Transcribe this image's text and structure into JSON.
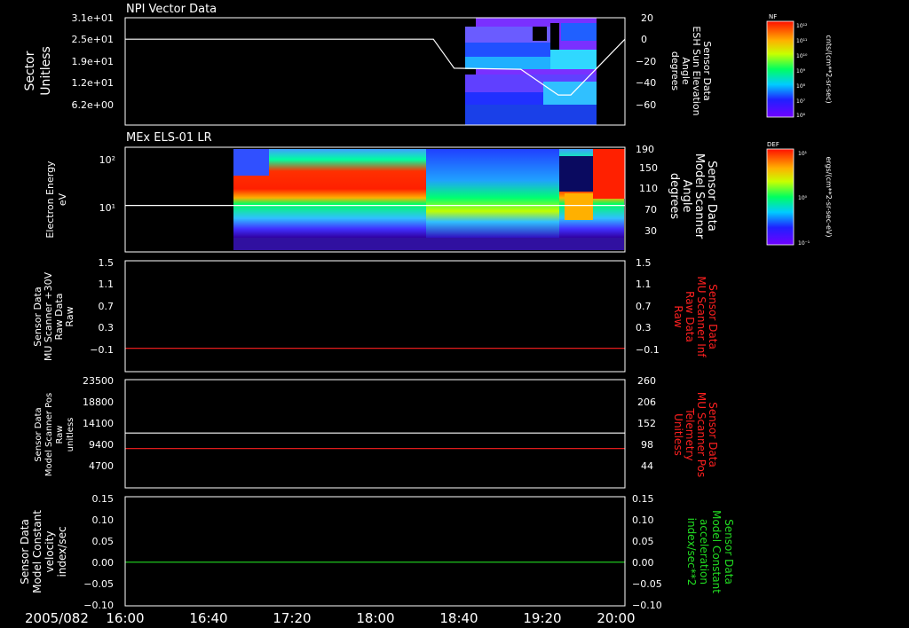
{
  "colors": {
    "background": "#000000",
    "frame": "#ffffff",
    "text": "#ffffff",
    "red_trace": "#ff2020",
    "green_trace": "#22dd22"
  },
  "date_label": "2005/082",
  "x_ticks": [
    "16:00",
    "16:40",
    "17:20",
    "18:00",
    "18:40",
    "19:20",
    "20:00"
  ],
  "chart_data": [
    {
      "type": "heatmap",
      "panel": "npi",
      "title": "NPI Vector Data",
      "ylabel": [
        "Sector",
        "Unitless"
      ],
      "yticks": [
        "3.1e+01",
        "2.5e+01",
        "1.9e+01",
        "1.2e+01",
        "6.2e+00"
      ],
      "right_ylabel": [
        "Sensor Data",
        "ESH Sun Elevation",
        "Angle",
        "degrees"
      ],
      "right_yticks": [
        "20",
        "0",
        "−20",
        "−40",
        "−60"
      ],
      "right_ylim": [
        -80,
        20
      ],
      "colorbar": {
        "name": "NF",
        "unit": "cnts/(cm**2-sr-sec)",
        "ticks": [
          "10¹²",
          "10¹¹",
          "10¹⁰",
          "10⁹",
          "10⁸",
          "10⁷",
          "10⁶"
        ]
      },
      "line_series": {
        "name": "ESH Sun Elevation Angle",
        "color": "#ffffff",
        "x": [
          "16:00",
          "18:28",
          "18:38",
          "19:10",
          "19:28",
          "19:34",
          "20:00"
        ],
        "y": [
          0,
          0,
          -27,
          -28,
          -52,
          -52,
          0
        ]
      }
    },
    {
      "type": "heatmap",
      "panel": "els",
      "title": "MEx ELS-01 LR",
      "ylabel": [
        "Electron Energy",
        "eV"
      ],
      "yticks": [
        "10²",
        "10¹"
      ],
      "right_ylabel": [
        "Sensor Data",
        "Model Scanner",
        "Angle",
        "degrees"
      ],
      "right_yticks": [
        "190",
        "150",
        "110",
        "70",
        "30"
      ],
      "right_ylim": [
        10,
        190
      ],
      "colorbar": {
        "name": "DEF",
        "unit": "ergs/(cm**2-sr-sec-eV)",
        "ticks": [
          "10¹",
          "10⁰",
          "10⁻¹"
        ]
      },
      "line_series": {
        "name": "Model Scanner Angle",
        "color": "#ffffff",
        "x": [
          "16:00",
          "20:00"
        ],
        "y": [
          90,
          90
        ]
      }
    },
    {
      "type": "line",
      "panel": "mu_raw",
      "ylabel": [
        "Sensor Data",
        "MU Scanner +30V",
        "Raw Data",
        "Raw"
      ],
      "yticks": [
        "1.5",
        "1.1",
        "0.7",
        "0.3",
        "−0.1"
      ],
      "ylim": [
        -0.4,
        1.5
      ],
      "right_ylabel": [
        "Sensor Data",
        "MU Scanner Inf",
        "Raw Data",
        "Raw"
      ],
      "right_yticks": [
        "1.5",
        "1.1",
        "0.7",
        "0.3",
        "−0.1"
      ],
      "series": [
        {
          "name": "MU Scanner Inf Raw Data",
          "color": "#ff2020",
          "x": [
            "16:00",
            "20:00"
          ],
          "y": [
            0.0,
            0.0
          ]
        }
      ]
    },
    {
      "type": "line",
      "panel": "scanner_pos",
      "ylabel": [
        "Sensor Data",
        "Model Scanner Pos",
        "Raw",
        "unitless"
      ],
      "yticks": [
        "23500",
        "18800",
        "14100",
        "9400",
        "4700"
      ],
      "ylim": [
        0,
        23500
      ],
      "right_ylabel": [
        "Sensor Data",
        "MU Scanner Pos",
        "Telemetry",
        "Unitless"
      ],
      "right_yticks": [
        "260",
        "206",
        "152",
        "98",
        "44"
      ],
      "right_ylim": [
        -10,
        260
      ],
      "series": [
        {
          "name": "Model Scanner Pos Raw",
          "color": "#ffffff",
          "x": [
            "16:00",
            "20:00"
          ],
          "y": [
            11900,
            11900
          ]
        },
        {
          "name": "MU Scanner Pos Telemetry",
          "color": "#ff2020",
          "x": [
            "16:00",
            "20:00"
          ],
          "y": [
            88,
            88
          ]
        }
      ]
    },
    {
      "type": "line",
      "panel": "constants",
      "ylabel": [
        "Sensor Data",
        "Model Constant",
        "velocity",
        "index/sec"
      ],
      "yticks": [
        "0.15",
        "0.10",
        "0.05",
        "0.00",
        "−0.05",
        "−0.10"
      ],
      "ylim": [
        -0.1,
        0.15
      ],
      "right_ylabel": [
        "Sensor Data",
        "Model Constant",
        "acceleration",
        "index/sec**2"
      ],
      "right_yticks": [
        "0.15",
        "0.10",
        "0.05",
        "0.00",
        "−0.05",
        "−0.10"
      ],
      "series": [
        {
          "name": "Model Constant acceleration",
          "color": "#22dd22",
          "x": [
            "16:00",
            "20:00"
          ],
          "y": [
            0,
            0
          ]
        }
      ]
    }
  ]
}
